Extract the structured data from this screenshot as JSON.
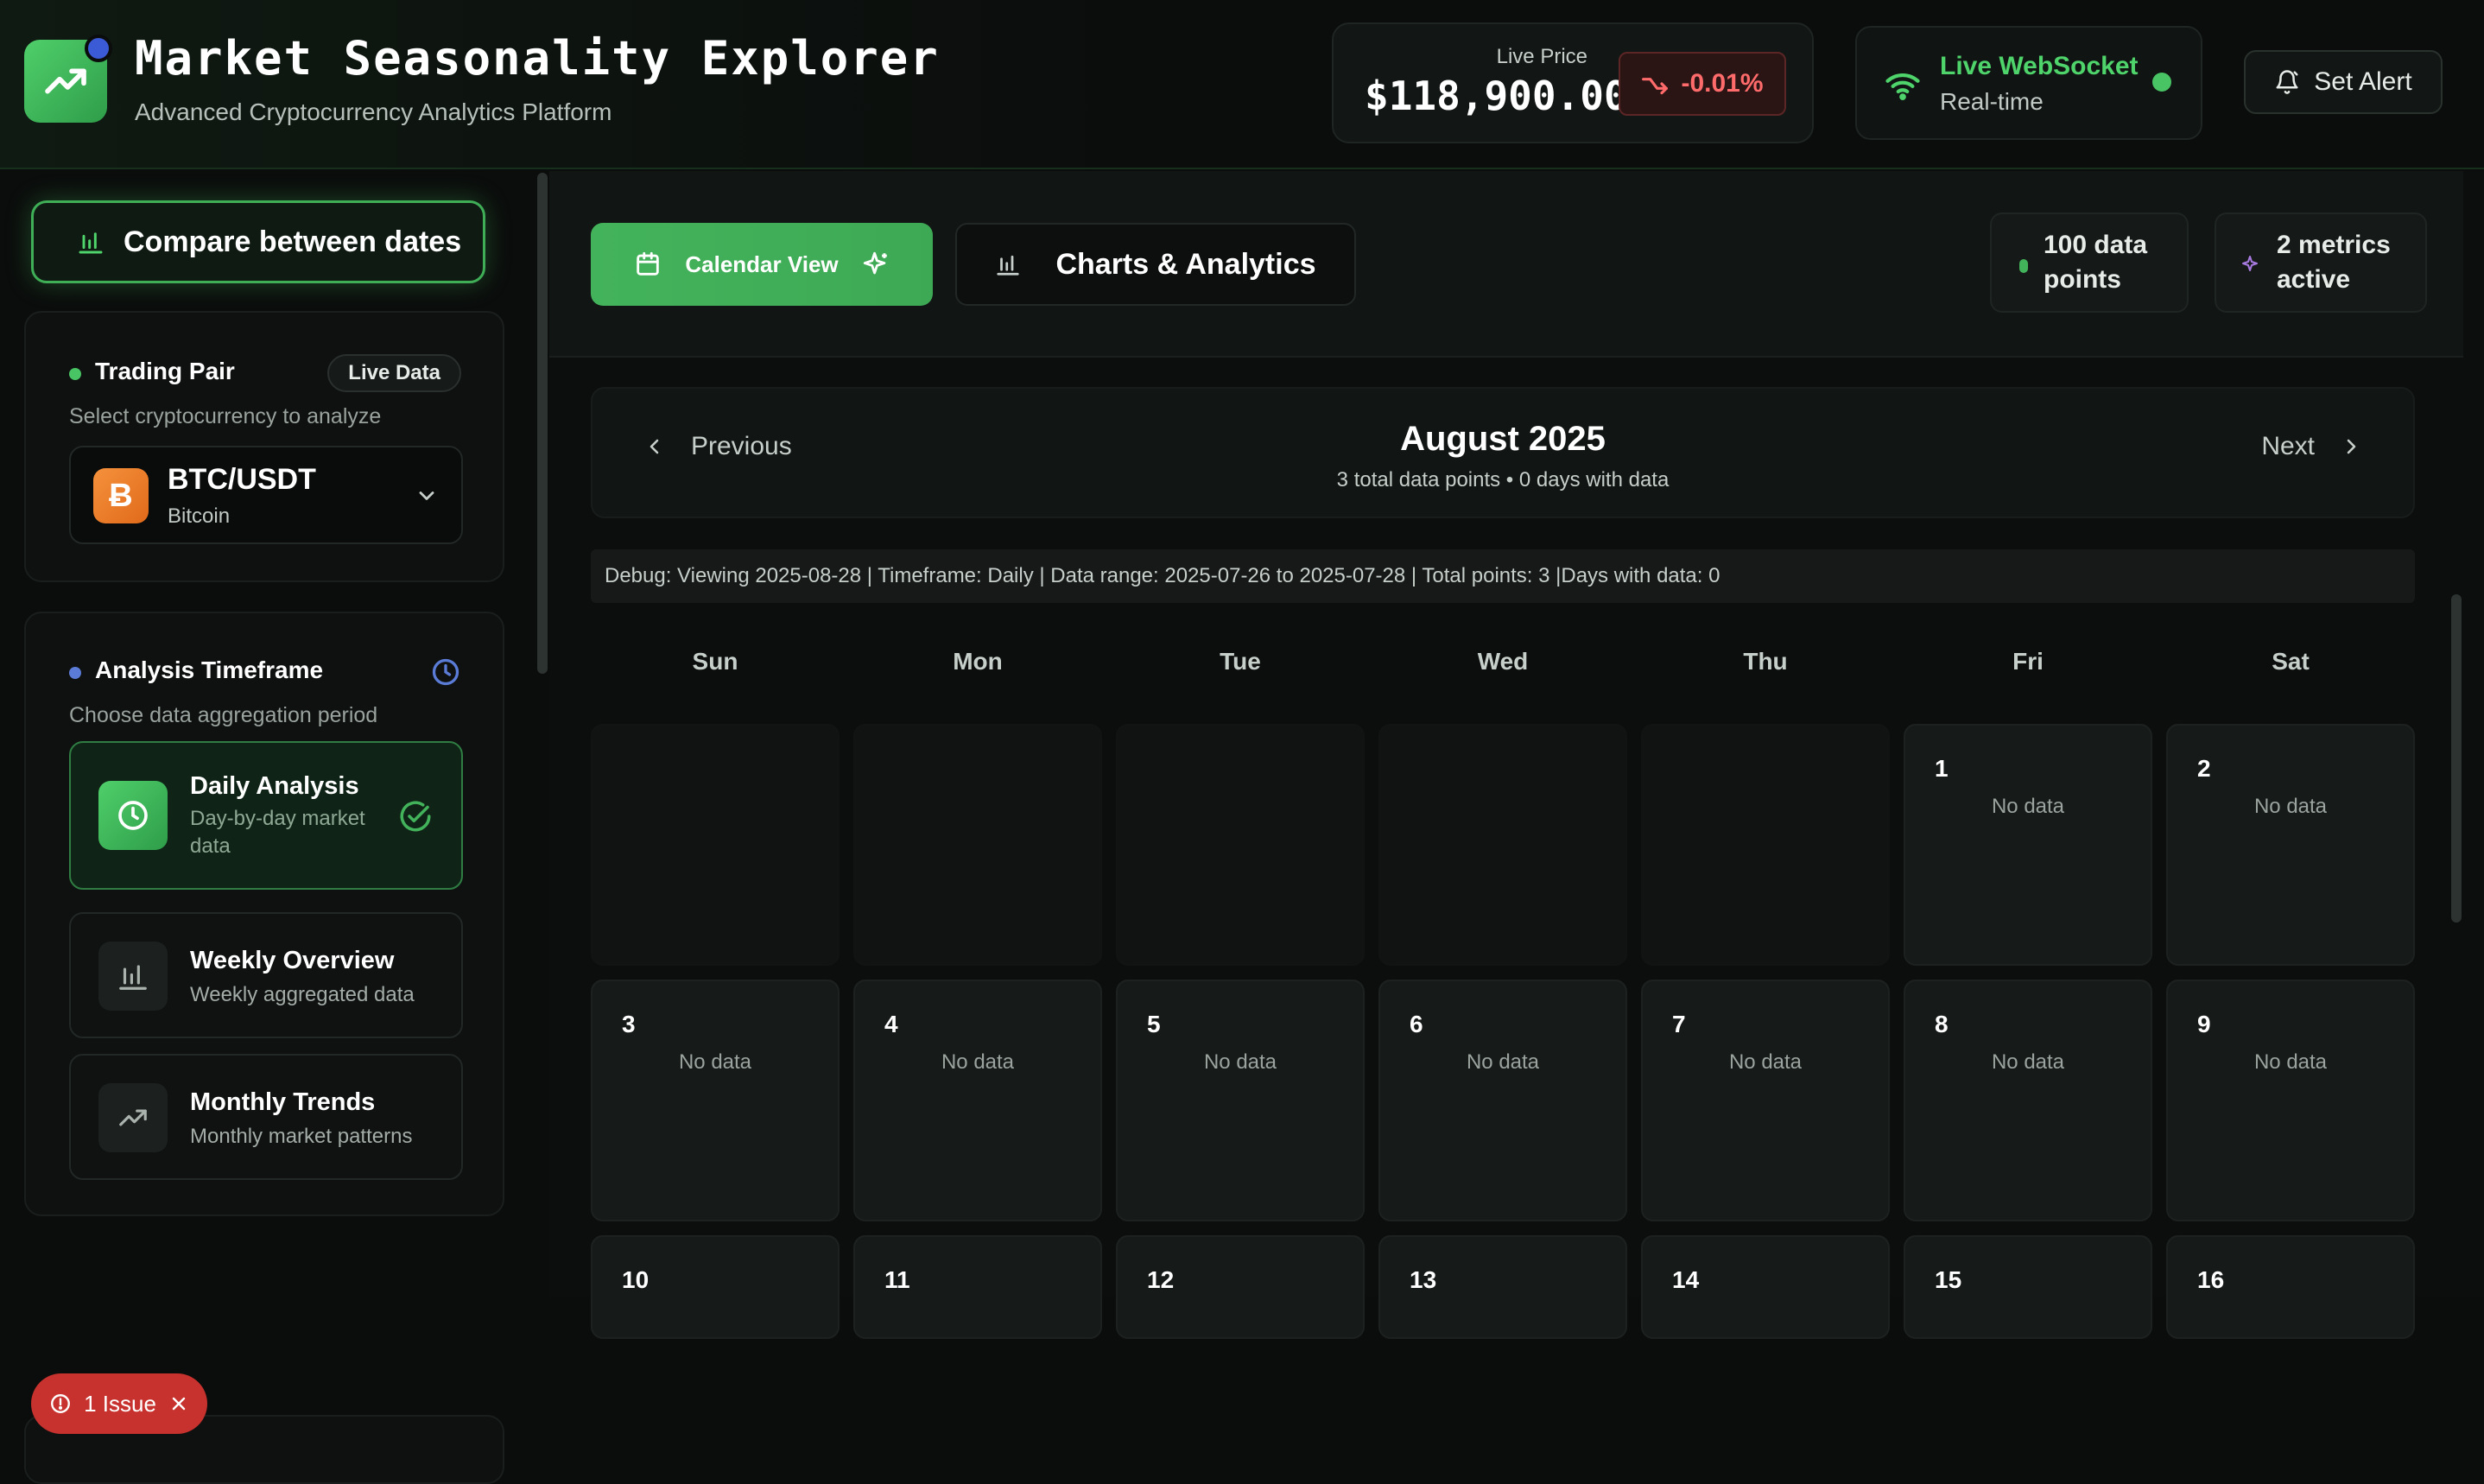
{
  "header": {
    "title": "Market Seasonality Explorer",
    "subtitle": "Advanced Cryptocurrency Analytics Platform",
    "live_price_label": "Live Price",
    "live_price": "$118,900.00",
    "price_change": "-0.01%",
    "ws_title": "Live WebSocket",
    "ws_sub": "Real-time",
    "alert_label": "Set Alert"
  },
  "sidebar": {
    "compare_label": "Compare between dates",
    "pair_panel": {
      "title": "Trading Pair",
      "badge": "Live Data",
      "subtitle": "Select cryptocurrency to analyze",
      "pair": "BTC/USDT",
      "pair_name": "Bitcoin",
      "coin_symbol": "Ƀ"
    },
    "timeframe_panel": {
      "title": "Analysis Timeframe",
      "subtitle": "Choose data aggregation period",
      "options": [
        {
          "name": "Daily Analysis",
          "desc": "Day-by-day market data",
          "selected": true
        },
        {
          "name": "Weekly Overview",
          "desc": "Weekly aggregated data",
          "selected": false
        },
        {
          "name": "Monthly Trends",
          "desc": "Monthly market patterns",
          "selected": false
        }
      ]
    },
    "issue_label": "1 Issue"
  },
  "main": {
    "tabs": {
      "calendar": "Calendar View",
      "charts": "Charts & Analytics"
    },
    "chips": {
      "points": [
        "100 data",
        "points"
      ],
      "metrics": [
        "2 metrics",
        "active"
      ]
    },
    "nav": {
      "prev": "Previous",
      "next": "Next",
      "month": "August 2025",
      "summary": "3 total data points • 0 days with data"
    },
    "debug": "Debug: Viewing 2025-08-28 | Timeframe: Daily | Data range: 2025-07-26 to 2025-07-28 | Total points: 3 |Days with data: 0",
    "weekdays": [
      "Sun",
      "Mon",
      "Tue",
      "Wed",
      "Thu",
      "Fri",
      "Sat"
    ],
    "no_data_label": "No data",
    "days": [
      "1",
      "2",
      "3",
      "4",
      "5",
      "6",
      "7",
      "8",
      "9",
      "10",
      "11",
      "12",
      "13",
      "14",
      "15",
      "16"
    ]
  },
  "colors": {
    "accent": "#43b35b",
    "negative": "#ff6b6b",
    "ws_green": "#4fd36b",
    "issue_red": "#c8322e",
    "btc_orange": "#f5913c"
  },
  "icons": {
    "logo": "trending-up-icon",
    "price_change": "trend-down-icon",
    "ws": "wifi-icon",
    "alert": "bell-icon",
    "compare": "bar-chart-icon",
    "timeframe": "clock-icon",
    "pair_select": "chevron-down-icon",
    "calendar": "calendar-icon",
    "sparkle": "sparkle-icon",
    "charts": "bar-chart-icon",
    "prev": "chevron-left-icon",
    "next": "chevron-right-icon",
    "issue": "alert-circle-icon",
    "issue_close": "close-icon"
  }
}
